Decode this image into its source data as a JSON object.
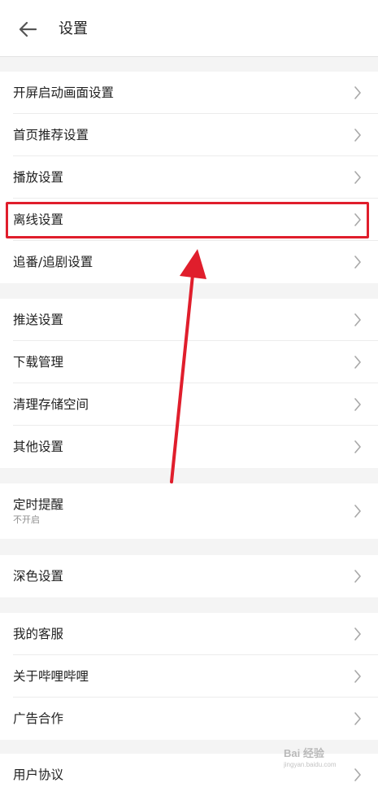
{
  "header": {
    "title": "设置",
    "back_icon": "arrow-left-icon"
  },
  "groups": [
    {
      "items": [
        {
          "label": "开屏启动画面设置"
        },
        {
          "label": "首页推荐设置"
        },
        {
          "label": "播放设置"
        },
        {
          "label": "离线设置",
          "highlighted": true
        },
        {
          "label": "追番/追剧设置"
        }
      ]
    },
    {
      "items": [
        {
          "label": "推送设置"
        },
        {
          "label": "下载管理"
        },
        {
          "label": "清理存储空间"
        },
        {
          "label": "其他设置"
        }
      ]
    },
    {
      "items": [
        {
          "label": "定时提醒",
          "sub": "不开启"
        }
      ]
    },
    {
      "items": [
        {
          "label": "深色设置"
        }
      ]
    },
    {
      "items": [
        {
          "label": "我的客服"
        },
        {
          "label": "关于哔哩哔哩"
        },
        {
          "label": "广告合作"
        }
      ]
    },
    {
      "items": [
        {
          "label": "用户协议"
        }
      ]
    }
  ],
  "annotation": {
    "color": "#e01e2c"
  },
  "watermark": {
    "text": "Bai 经验",
    "sub": "jingyan.baidu.com"
  }
}
